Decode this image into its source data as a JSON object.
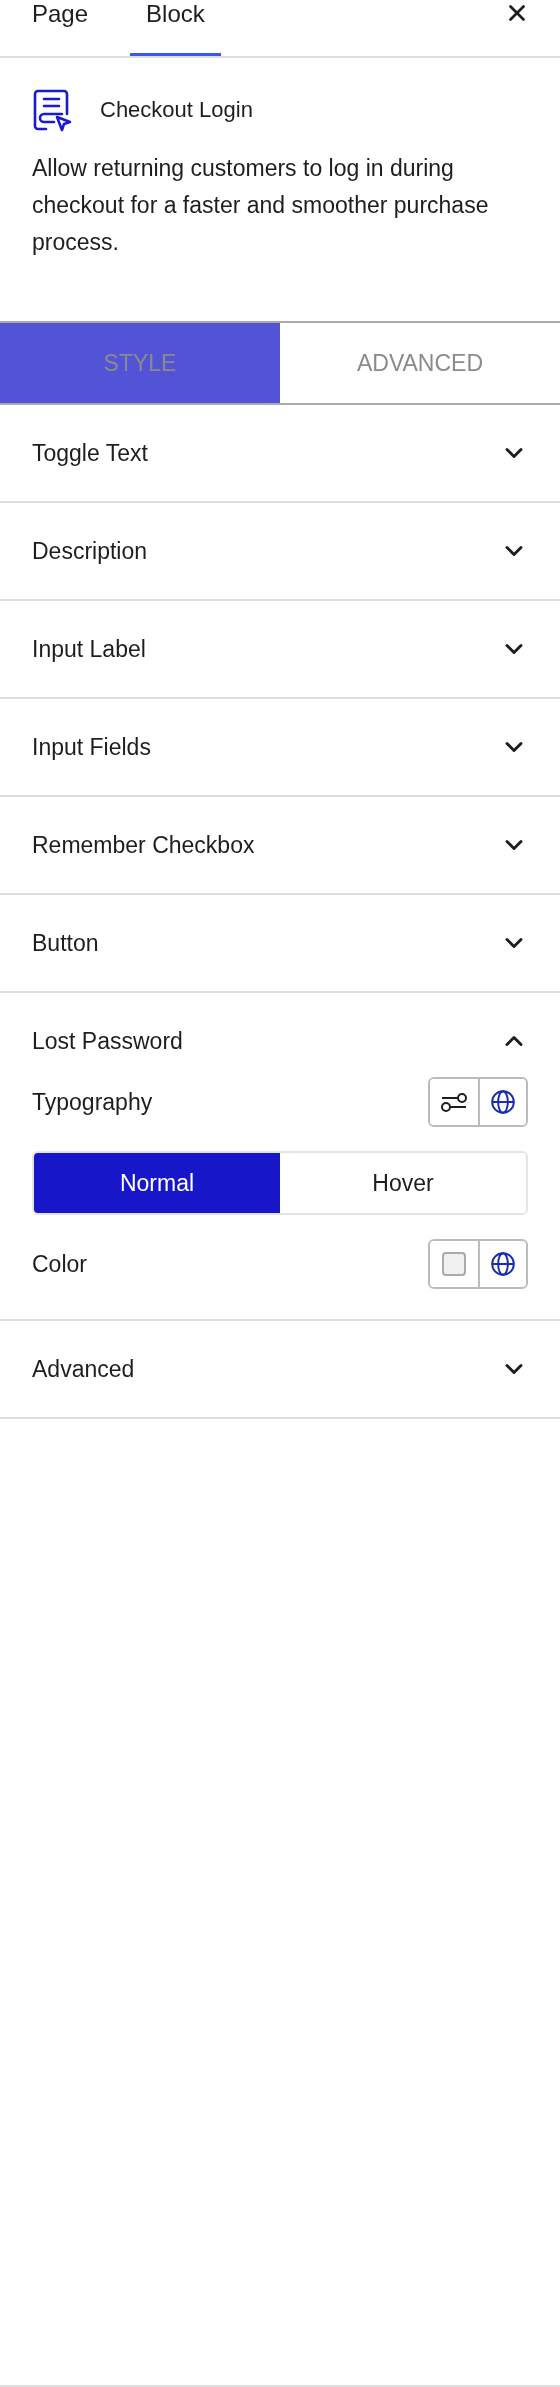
{
  "top_tabs": [
    {
      "label": "Page",
      "selected": false
    },
    {
      "label": "Block",
      "selected": true
    }
  ],
  "block": {
    "title": "Checkout Login",
    "description": "Allow returning customers to log in during checkout for a faster and smoother purchase process."
  },
  "style_tabs": [
    {
      "label": "STYLE",
      "selected": true
    },
    {
      "label": "ADVANCED",
      "selected": false
    }
  ],
  "sections": [
    {
      "title": "Toggle Text",
      "expanded": false
    },
    {
      "title": "Description",
      "expanded": false
    },
    {
      "title": "Input Label",
      "expanded": false
    },
    {
      "title": "Input Fields",
      "expanded": false
    },
    {
      "title": "Remember Checkbox",
      "expanded": false
    },
    {
      "title": "Button",
      "expanded": false
    },
    {
      "title": "Lost Password",
      "expanded": true,
      "controls": [
        {
          "kind": "typography",
          "label": "Typography"
        },
        {
          "kind": "state_tabs",
          "tabs": [
            {
              "label": "Normal",
              "selected": true
            },
            {
              "label": "Hover",
              "selected": false
            }
          ]
        },
        {
          "kind": "color",
          "label": "Color"
        }
      ]
    },
    {
      "title": "Advanced",
      "expanded": false
    }
  ]
}
